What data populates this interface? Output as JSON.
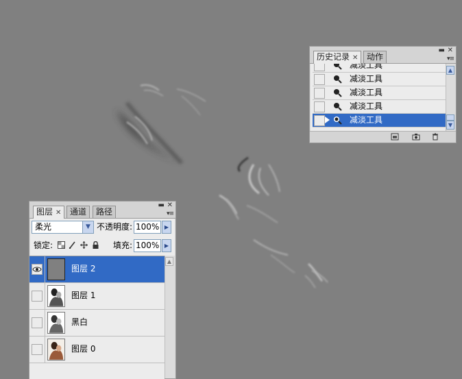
{
  "history_panel": {
    "tabs": [
      {
        "label": "历史记录",
        "active": true,
        "closable": true
      },
      {
        "label": "动作",
        "active": false,
        "closable": false
      }
    ],
    "states": [
      {
        "label": "减淡工具",
        "icon": "dodge-tool-icon",
        "selected": false
      },
      {
        "label": "减淡工具",
        "icon": "dodge-tool-icon",
        "selected": false
      },
      {
        "label": "减淡工具",
        "icon": "dodge-tool-icon",
        "selected": false
      },
      {
        "label": "减淡工具",
        "icon": "dodge-tool-icon",
        "selected": false
      },
      {
        "label": "减淡工具",
        "icon": "dodge-tool-icon",
        "selected": true
      }
    ],
    "footer_icons": [
      "new-document-from-state-icon",
      "snapshot-camera-icon",
      "trash-icon"
    ]
  },
  "layers_panel": {
    "tabs": [
      {
        "label": "图层",
        "active": true,
        "closable": true
      },
      {
        "label": "通道",
        "active": false,
        "closable": false
      },
      {
        "label": "路径",
        "active": false,
        "closable": false
      }
    ],
    "blend_mode": "柔光",
    "opacity_label": "不透明度:",
    "opacity_value": "100%",
    "lock_label": "锁定:",
    "fill_label": "填充:",
    "fill_value": "100%",
    "lock_icons": [
      "lock-transparency-icon",
      "lock-image-icon",
      "lock-position-icon",
      "lock-all-icon"
    ],
    "layers": [
      {
        "name": "图层 2",
        "visible": true,
        "selected": true,
        "thumb": "gray-fill"
      },
      {
        "name": "图层 1",
        "visible": false,
        "selected": false,
        "thumb": "photo-bw"
      },
      {
        "name": "黑白",
        "visible": false,
        "selected": false,
        "thumb": "photo-bw"
      },
      {
        "name": "图层 0",
        "visible": false,
        "selected": false,
        "thumb": "photo-color"
      }
    ]
  },
  "colors": {
    "canvas_bg": "#808080",
    "panel_bg": "#ececec",
    "selection": "#316ac5"
  }
}
